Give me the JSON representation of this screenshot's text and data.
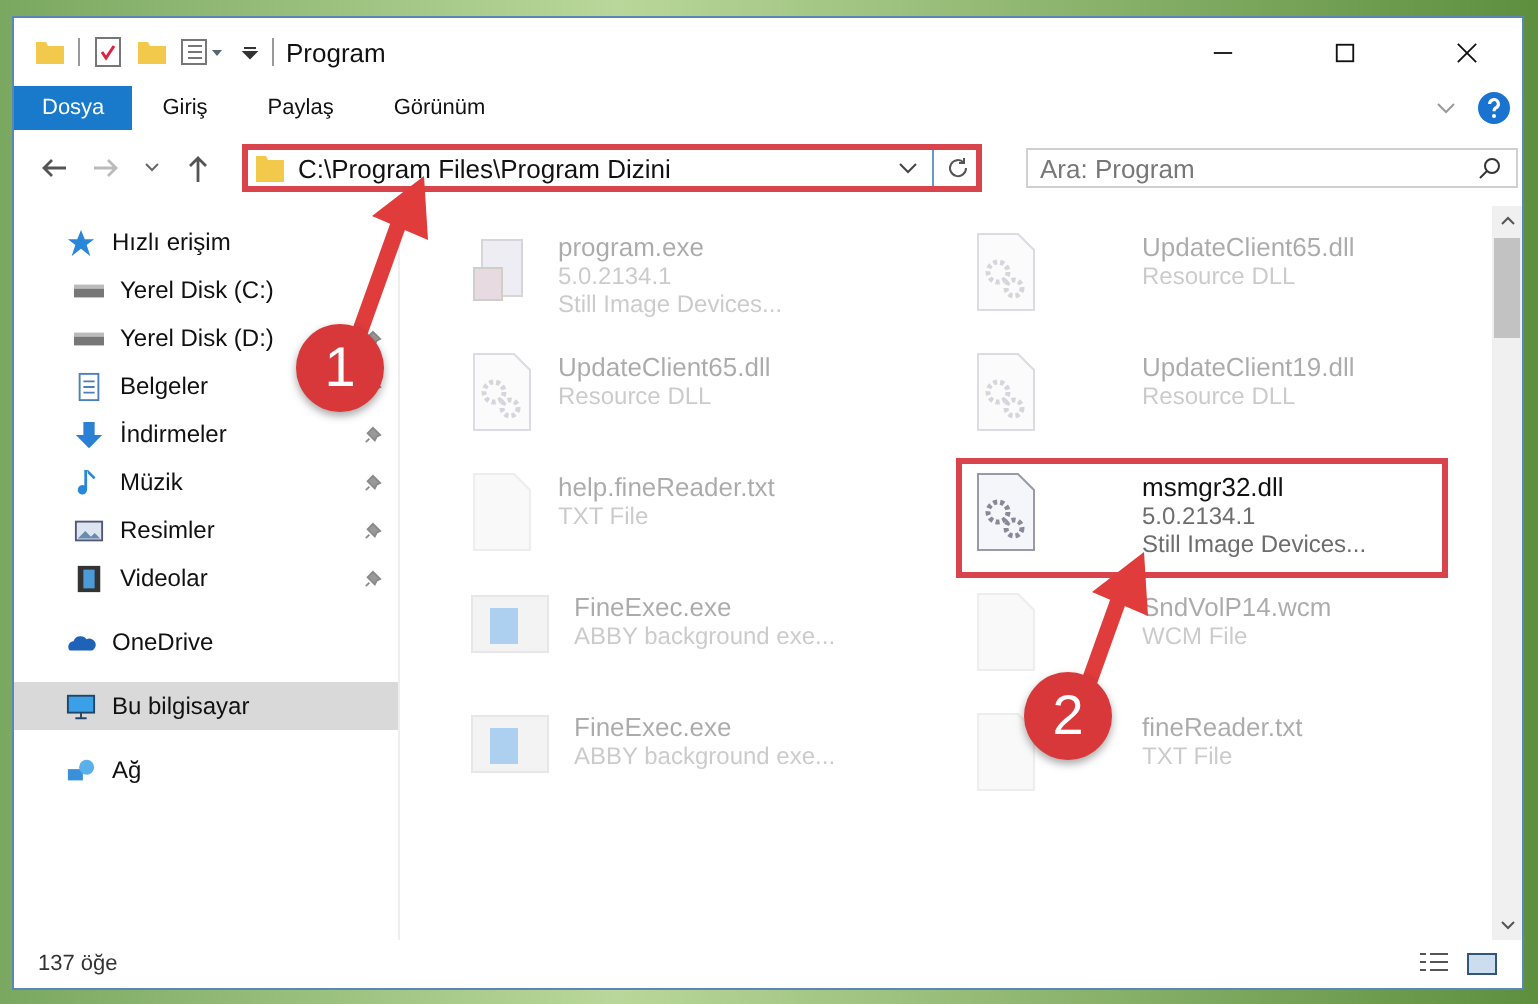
{
  "window": {
    "title": "Program"
  },
  "ribbon_tabs": [
    {
      "label": "Dosya",
      "selected": true
    },
    {
      "label": "Giriş",
      "selected": false
    },
    {
      "label": "Paylaş",
      "selected": false
    },
    {
      "label": "Görünüm",
      "selected": false
    }
  ],
  "address": {
    "value": "C:\\Program Files\\Program Dizini",
    "highlighted": true
  },
  "search": {
    "placeholder": "Ara: Program"
  },
  "sidebar": {
    "items": [
      {
        "label": "Hızlı erişim",
        "kind": "star",
        "pinned": false,
        "selected": false,
        "children": [
          {
            "label": "Yerel Disk (C:)",
            "kind": "drive",
            "pinned": false,
            "selected": false
          },
          {
            "label": "Yerel Disk (D:)",
            "kind": "drive",
            "pinned": true,
            "selected": false
          },
          {
            "label": "Belgeler",
            "kind": "docs",
            "pinned": true,
            "selected": false
          },
          {
            "label": "İndirmeler",
            "kind": "download",
            "pinned": true,
            "selected": false
          },
          {
            "label": "Müzik",
            "kind": "music",
            "pinned": true,
            "selected": false
          },
          {
            "label": "Resimler",
            "kind": "pictures",
            "pinned": true,
            "selected": false
          },
          {
            "label": "Videolar",
            "kind": "video",
            "pinned": true,
            "selected": false
          }
        ]
      },
      {
        "label": "OneDrive",
        "kind": "cloud",
        "pinned": false,
        "selected": false
      },
      {
        "label": "Bu bilgisayar",
        "kind": "computer",
        "pinned": false,
        "selected": true
      },
      {
        "label": "Ağ",
        "kind": "network",
        "pinned": false,
        "selected": false
      }
    ]
  },
  "files": [
    {
      "name": "program.exe",
      "lines": [
        "5.0.2134.1",
        "Still Image Devices..."
      ],
      "kind": "installer",
      "highlighted": false
    },
    {
      "name": "UpdateClient65.dll",
      "lines": [
        "Resource DLL"
      ],
      "kind": "dll",
      "highlighted": false
    },
    {
      "name": "UpdateClient65.dll",
      "lines": [
        "Resource DLL"
      ],
      "kind": "dll",
      "highlighted": false
    },
    {
      "name": "UpdateClient19.dll",
      "lines": [
        "Resource DLL"
      ],
      "kind": "dll",
      "highlighted": false
    },
    {
      "name": "help.fineReader.txt",
      "lines": [
        "TXT File"
      ],
      "kind": "text",
      "highlighted": false
    },
    {
      "name": "msmgr32.dll",
      "lines": [
        "5.0.2134.1",
        "Still Image Devices..."
      ],
      "kind": "dll",
      "highlighted": true
    },
    {
      "name": "FineExec.exe",
      "lines": [
        "ABBY background exe..."
      ],
      "kind": "app",
      "highlighted": false
    },
    {
      "name": "SndVolP14.wcm",
      "lines": [
        "WCM File"
      ],
      "kind": "text",
      "highlighted": false
    },
    {
      "name": "FineExec.exe",
      "lines": [
        "ABBY background exe..."
      ],
      "kind": "app",
      "highlighted": false
    },
    {
      "name": "fineReader.txt",
      "lines": [
        "TXT File"
      ],
      "kind": "text",
      "highlighted": false
    }
  ],
  "status_bar": {
    "count": "137 öğe"
  },
  "callouts": [
    {
      "number": "1"
    },
    {
      "number": "2"
    }
  ]
}
